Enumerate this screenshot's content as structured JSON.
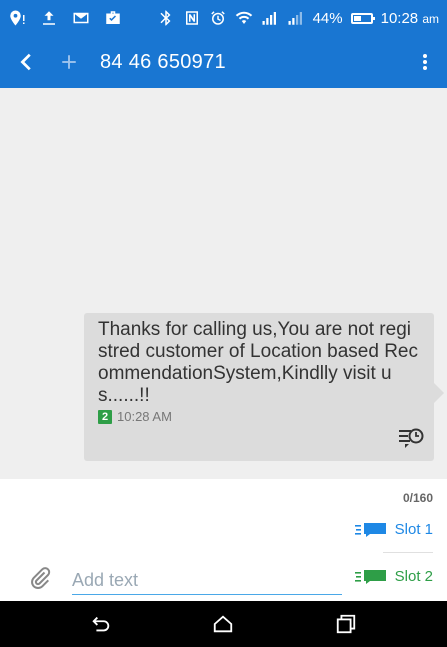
{
  "status_bar": {
    "battery": "44%",
    "battery_level": 0.44,
    "time": "10:28",
    "ampm": "am"
  },
  "app_bar": {
    "contact": "84 46 650971"
  },
  "message": {
    "text": "Thanks for calling us,You are not registred customer of Location based RecommendationSystem,Kindlly visit us......!!",
    "sim": "2",
    "time": "10:28 AM"
  },
  "compose": {
    "counter": "0/160",
    "slot1": "Slot 1",
    "slot2": "Slot 2",
    "placeholder": "Add text"
  },
  "colors": {
    "primary": "#1976d2",
    "slot1": "#1e88e5",
    "slot2": "#2e9e47"
  }
}
